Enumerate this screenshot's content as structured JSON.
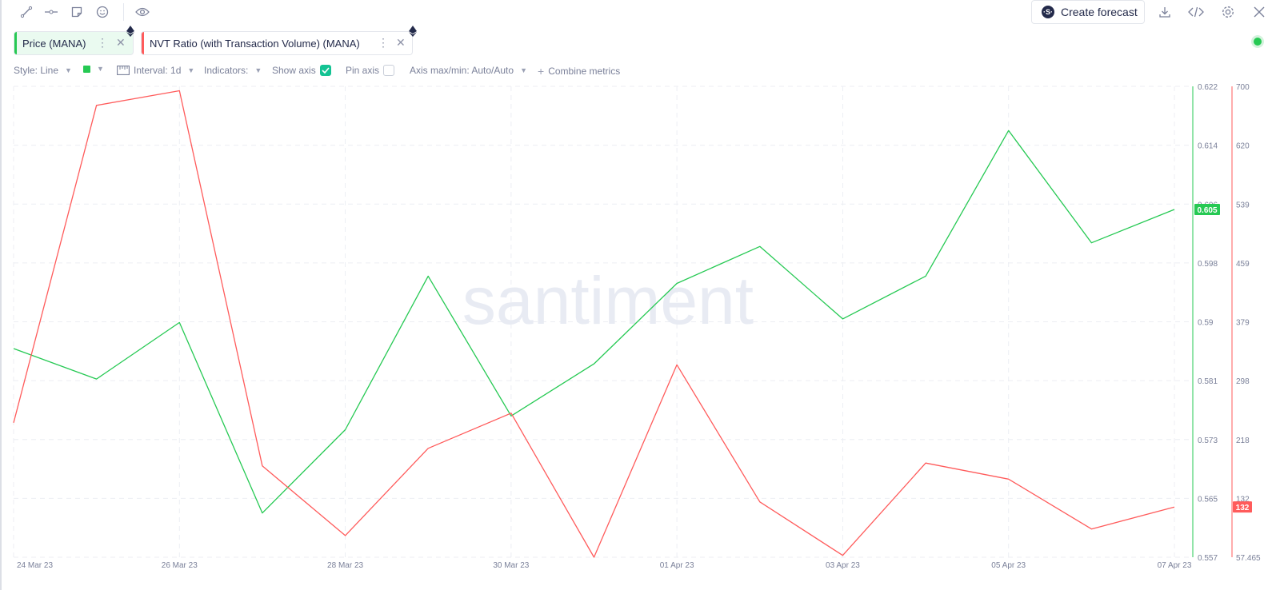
{
  "toolbar": {
    "tools": [
      {
        "icon": "line-drawing-icon"
      },
      {
        "icon": "horizontal-line-icon"
      },
      {
        "icon": "note-icon"
      },
      {
        "icon": "emoji-icon"
      },
      {
        "icon": "eye-icon"
      }
    ],
    "create_forecast_label": "Create forecast",
    "right_icons": [
      "download-icon",
      "embed-code-icon",
      "settings-icon",
      "close-icon"
    ]
  },
  "metrics": [
    {
      "label": "Price (MANA)",
      "color": "#26c953",
      "chip_bg": "#eafaf0"
    },
    {
      "label": "NVT Ratio (with Transaction Volume) (MANA)",
      "color": "#ff5b5b",
      "chip_bg": "#ffffff"
    }
  ],
  "settings": {
    "style": "Style: Line",
    "interval": "Interval: 1d",
    "indicators": "Indicators:",
    "show_axis": "Show axis",
    "show_axis_checked": true,
    "pin_axis": "Pin axis",
    "pin_axis_checked": false,
    "axis_maxmin": "Axis max/min: Auto/Auto",
    "combine": "Combine metrics"
  },
  "watermark": "santiment",
  "chart_data": {
    "type": "line",
    "x": [
      "24 Mar 23",
      "25 Mar 23",
      "26 Mar 23",
      "27 Mar 23",
      "28 Mar 23",
      "29 Mar 23",
      "30 Mar 23",
      "31 Mar 23",
      "01 Apr 23",
      "02 Apr 23",
      "03 Apr 23",
      "04 Apr 23",
      "05 Apr 23",
      "06 Apr 23",
      "07 Apr 23"
    ],
    "x_tick_labels": [
      "24 Mar 23",
      "26 Mar 23",
      "28 Mar 23",
      "30 Mar 23",
      "01 Apr 23",
      "03 Apr 23",
      "05 Apr 23",
      "07 Apr 23"
    ],
    "series": [
      {
        "name": "Price (MANA)",
        "axis": "left",
        "color": "#26c953",
        "values": [
          0.5858,
          0.5816,
          0.5894,
          0.5631,
          0.5746,
          0.5958,
          0.5765,
          0.5837,
          0.5948,
          0.5999,
          0.5899,
          0.5958,
          0.6159,
          0.6004,
          0.605
        ],
        "last_value_label": "0.605"
      },
      {
        "name": "NVT Ratio (with Transaction Volume) (MANA)",
        "axis": "right",
        "color": "#ff5b5b",
        "values": [
          241,
          674,
          694,
          182,
          87,
          206,
          254,
          57.5,
          320,
          133,
          60,
          186,
          164,
          96,
          126
        ],
        "last_value_label": "132"
      }
    ],
    "price_axis": {
      "ticks": [
        "0.622",
        "0.614",
        "0.606",
        "0.598",
        "0.59",
        "0.581",
        "0.573",
        "0.565",
        "0.557"
      ],
      "range": [
        0.557,
        0.622
      ],
      "color": "#26c953"
    },
    "nvt_axis": {
      "ticks": [
        "700",
        "620",
        "539",
        "459",
        "379",
        "298",
        "218",
        "132",
        "57.465"
      ],
      "range": [
        57.465,
        700
      ],
      "color": "#ff5b5b"
    },
    "grid": true
  }
}
